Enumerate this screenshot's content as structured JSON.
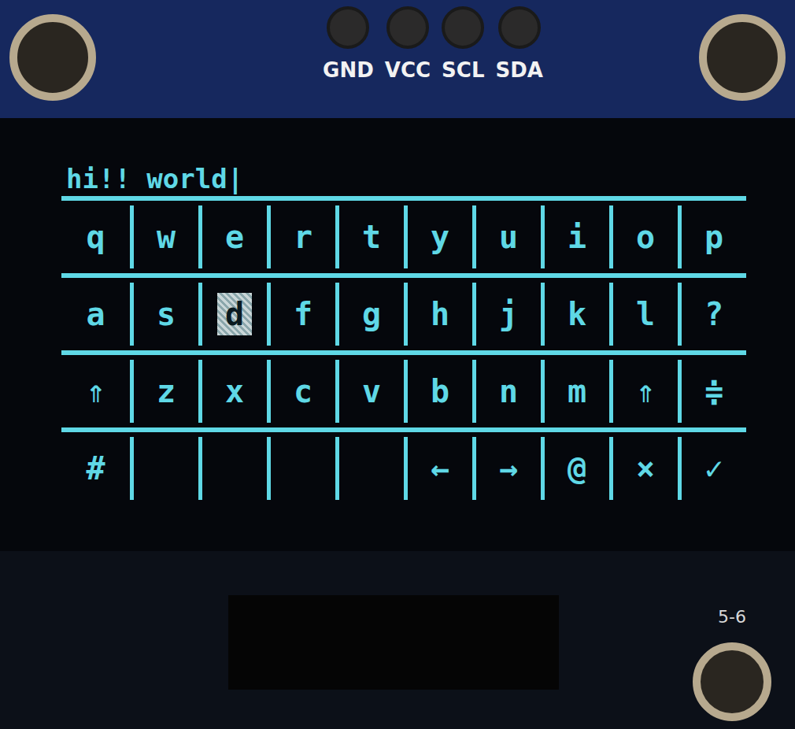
{
  "board": {
    "pins": [
      "GND",
      "VCC",
      "SCL",
      "SDA"
    ],
    "label": "5-6"
  },
  "screen": {
    "input": "hi!! world|",
    "keys": [
      [
        {
          "label": "q",
          "selected": false
        },
        {
          "label": "w",
          "selected": false
        },
        {
          "label": "e",
          "selected": false
        },
        {
          "label": "r",
          "selected": false
        },
        {
          "label": "t",
          "selected": false
        },
        {
          "label": "y",
          "selected": false
        },
        {
          "label": "u",
          "selected": false
        },
        {
          "label": "i",
          "selected": false
        },
        {
          "label": "o",
          "selected": false
        },
        {
          "label": "p",
          "selected": false
        }
      ],
      [
        {
          "label": "a",
          "selected": false
        },
        {
          "label": "s",
          "selected": false
        },
        {
          "label": "d",
          "selected": true
        },
        {
          "label": "f",
          "selected": false
        },
        {
          "label": "g",
          "selected": false
        },
        {
          "label": "h",
          "selected": false
        },
        {
          "label": "j",
          "selected": false
        },
        {
          "label": "k",
          "selected": false
        },
        {
          "label": "l",
          "selected": false
        },
        {
          "label": "?",
          "selected": false
        }
      ],
      [
        {
          "label": "⇑",
          "selected": false
        },
        {
          "label": "z",
          "selected": false
        },
        {
          "label": "x",
          "selected": false
        },
        {
          "label": "c",
          "selected": false
        },
        {
          "label": "v",
          "selected": false
        },
        {
          "label": "b",
          "selected": false
        },
        {
          "label": "n",
          "selected": false
        },
        {
          "label": "m",
          "selected": false
        },
        {
          "label": "⇑",
          "selected": false
        },
        {
          "label": "≑",
          "selected": false
        }
      ],
      [
        {
          "label": "#",
          "selected": false
        },
        {
          "label": "",
          "selected": false
        },
        {
          "label": "",
          "selected": false
        },
        {
          "label": "",
          "selected": false
        },
        {
          "label": "",
          "selected": false
        },
        {
          "label": "←",
          "selected": false
        },
        {
          "label": "→",
          "selected": false
        },
        {
          "label": "@",
          "selected": false
        },
        {
          "label": "×",
          "selected": false
        },
        {
          "label": "✓",
          "selected": false
        }
      ]
    ]
  }
}
